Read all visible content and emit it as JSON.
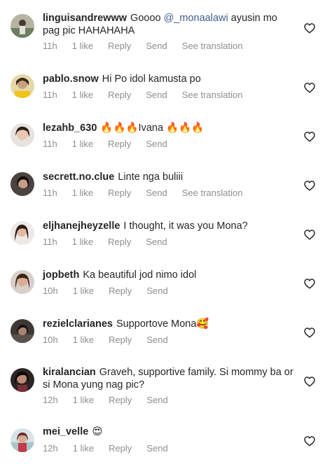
{
  "meta_labels": {
    "reply": "Reply",
    "send": "Send",
    "see_translation": "See translation"
  },
  "comments": [
    {
      "user": "linguisandrewww",
      "text_before": "Goooo",
      "mention": "@_monaalawi",
      "text_after": "ayusin mo pag pic HAHAHAHA",
      "time": "11h",
      "likes": "1 like",
      "show_translation": true
    },
    {
      "user": "pablo.snow",
      "text": "Hi Po idol kamusta po",
      "time": "11h",
      "likes": "1 like",
      "show_translation": true
    },
    {
      "user": "lezahb_630",
      "text": "🔥🔥🔥Ivana 🔥🔥🔥",
      "time": "11h",
      "likes": "1 like",
      "show_translation": false
    },
    {
      "user": "secrett.no.clue",
      "text": "Linte nga buliii",
      "time": "11h",
      "likes": "1 like",
      "show_translation": true
    },
    {
      "user": "eljhanejheyzelle",
      "text": "I thought, it was you Mona?",
      "time": "11h",
      "likes": "1 like",
      "show_translation": false
    },
    {
      "user": "jopbeth",
      "text": "Ka beautiful jod nimo idol",
      "time": "10h",
      "likes": "1 like",
      "show_translation": false
    },
    {
      "user": "rezielclarianes",
      "text": "Supportove Mona🥰",
      "time": "10h",
      "likes": "1 like",
      "show_translation": false
    },
    {
      "user": "kiralancian",
      "text": "Graveh, supportive family. Si mommy ba or si Mona yung nag pic?",
      "time": "12h",
      "likes": "1 like",
      "show_translation": false
    },
    {
      "user": "mei_velle",
      "text": "😍",
      "time": "12h",
      "likes": "1 like",
      "show_translation": false
    }
  ],
  "icons": {
    "like": "heart-outline-icon",
    "avatar": "profile-photo"
  },
  "colors": {
    "username": "#262626",
    "meta": "#8e8e8e",
    "mention": "#3f5e8c",
    "heart": "#262626"
  }
}
